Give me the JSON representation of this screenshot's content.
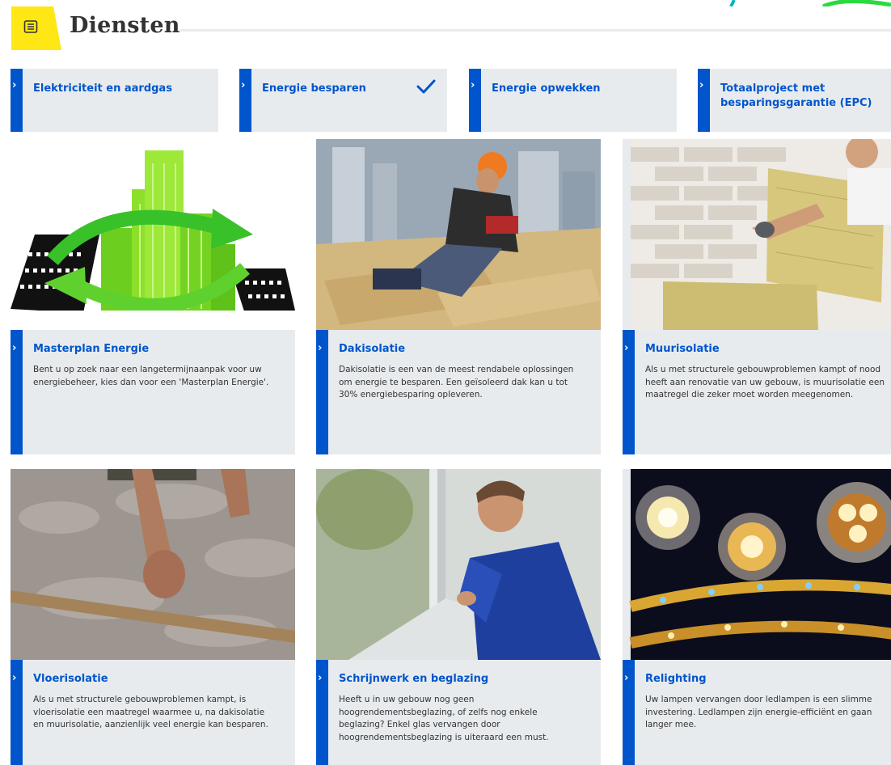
{
  "header": {
    "title": "Diensten",
    "icon": "document-list-icon",
    "accent_color": "#ffe615"
  },
  "categories": [
    {
      "label": "Elektriciteit en aardgas",
      "selected": false
    },
    {
      "label": "Energie besparen",
      "selected": true
    },
    {
      "label": "Energie opwekken",
      "selected": false
    },
    {
      "label": "Totaalproject met besparingsgarantie (EPC)",
      "selected": false
    }
  ],
  "cards": [
    {
      "title": "Masterplan Energie",
      "description": "Bent u op zoek naar een langetermijnaanpak voor uw energiebeheer, kies dan voor een 'Masterplan Energie'.",
      "image": "green-city-illustration"
    },
    {
      "title": "Dakisolatie",
      "description": "Dakisolatie is een van de meest rendabele oplossingen om energie te besparen. Een geïsoleerd dak kan u tot 30% energiebesparing opleveren.",
      "image": "roof-insulation-worker-photo"
    },
    {
      "title": "Muurisolatie",
      "description": "Als u met structurele gebouwproblemen kampt of nood heeft aan renovatie van uw gebouw, is muurisolatie een maatregel die zeker moet worden meegenomen.",
      "image": "wall-insulation-photo"
    },
    {
      "title": "Vloerisolatie",
      "description": "Als u met structurele gebouwproblemen kampt, is vloerisolatie een maatregel waarmee u, na dakisolatie en muurisolatie, aanzienlijk veel energie kan besparen.",
      "image": "floor-insulation-photo"
    },
    {
      "title": "Schrijnwerk en beglazing",
      "description": "Heeft u in uw gebouw nog geen hoogrendementsbeglazing, of zelfs nog enkele beglazing? Enkel glas vervangen door hoogrendementsbeglazing is uiteraard een must.",
      "image": "window-installer-photo"
    },
    {
      "title": "Relighting",
      "description": "Uw lampen vervangen door ledlampen is een slimme investering. Ledlampen zijn energie-efficiënt en gaan langer mee.",
      "image": "led-lamps-photo"
    }
  ],
  "colors": {
    "accent_blue": "#0055cc",
    "panel_grey": "#e8ebee",
    "text": "#333332"
  }
}
